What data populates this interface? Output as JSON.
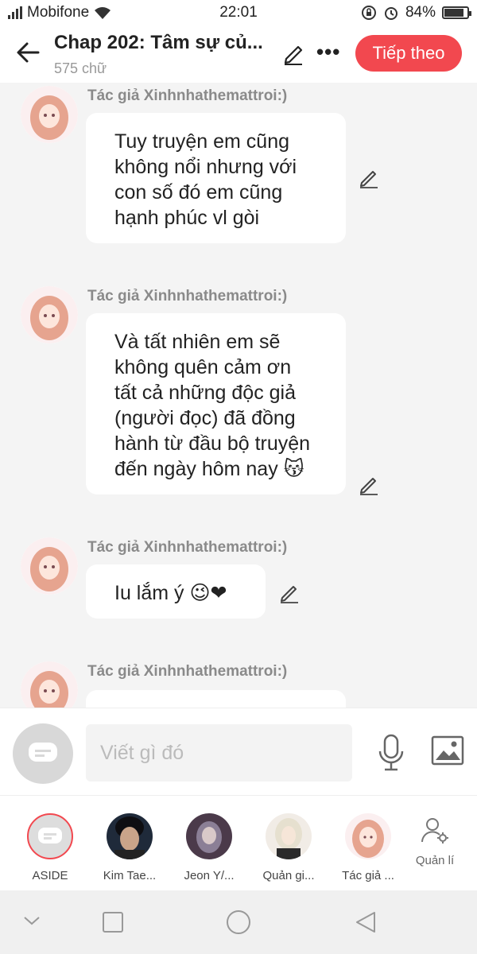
{
  "status": {
    "carrier": "Mobifone",
    "time": "22:01",
    "battery": "84%",
    "battery_level": 0.84
  },
  "header": {
    "title": "Chap 202: Tâm sự củ...",
    "word_count": "575 chữ",
    "next_label": "Tiếp theo",
    "more_glyph": "•••"
  },
  "messages": [
    {
      "author": "Tác giả Xinhnhathemattroi:)",
      "text": "Tuy truyện em cũng\nkhông nổi nhưng với\ncon số đó em cũng\nhạnh phúc vl gòi"
    },
    {
      "author": "Tác giả Xinhnhathemattroi:)",
      "text": "Và tất nhiên em sẽ\nkhông quên cảm ơn\ntất cả những độc giả\n(người đọc) đã đồng\nhành từ đầu bộ truyện\nđến ngày hôm nay 😽"
    },
    {
      "author": "Tác giả Xinhnhathemattroi:)",
      "text": "Iu lắm ý 😉❤"
    },
    {
      "author": "Tác giả Xinhnhathemattroi:)",
      "text": ""
    }
  ],
  "composer": {
    "placeholder": "Viết gì đó"
  },
  "characters": [
    {
      "name": "ASIDE"
    },
    {
      "name": "Kim Tae..."
    },
    {
      "name": "Jeon Y/..."
    },
    {
      "name": "Quản gi..."
    },
    {
      "name": "Tác giả ..."
    },
    {
      "name": "Quản lí"
    }
  ],
  "colors": {
    "accent": "#f2484f",
    "background": "#f4f4f4",
    "author": "#8a8a8a"
  }
}
